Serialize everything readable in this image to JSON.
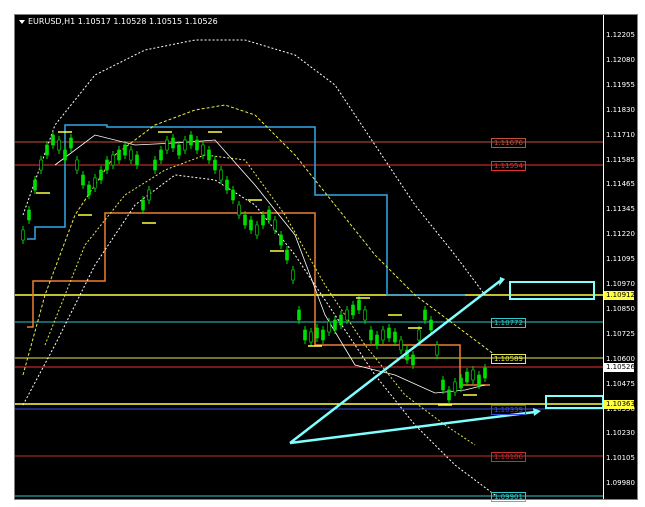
{
  "chart_window": {
    "title": "EURUSD,H1  1.10517 1.10528 1.10515 1.10526",
    "symbol": "EURUSD",
    "timeframe": "H1",
    "ohlc": [
      "1.10517",
      "1.10528",
      "1.10515",
      "1.10526"
    ]
  },
  "price_axis": {
    "labels": [
      "1.12205",
      "1.12080",
      "1.11955",
      "1.11830",
      "1.11710",
      "1.11585",
      "1.11465",
      "1.11345",
      "1.11220",
      "1.11095",
      "1.10970",
      "1.10850",
      "1.10725",
      "1.10600",
      "1.10475",
      "1.10350",
      "1.10230",
      "1.10105",
      "1.09980"
    ]
  },
  "price_tags": {
    "current": "1.10526",
    "level_10912": "1.10912",
    "level_10363": "1.10363"
  },
  "levels": [
    {
      "label": "1.11676",
      "color": "#c0503c"
    },
    {
      "label": "1.11554",
      "color": "#e83030"
    },
    {
      "label": "1.10772",
      "color": "#30c8c8"
    },
    {
      "label": "1.10589",
      "color": "#e8e850"
    },
    {
      "label": "1.10339",
      "color": "#3050e8"
    },
    {
      "label": "1.10106",
      "color": "#c03030"
    },
    {
      "label": "1.09901",
      "color": "#30c8c8"
    }
  ],
  "colors": {
    "background": "#000000",
    "candles": "#00e000",
    "support_resistance": "#ffff40",
    "arrows": "#80ffff",
    "channel_blue": "#30a8e8",
    "channel_orange": "#f08030"
  }
}
